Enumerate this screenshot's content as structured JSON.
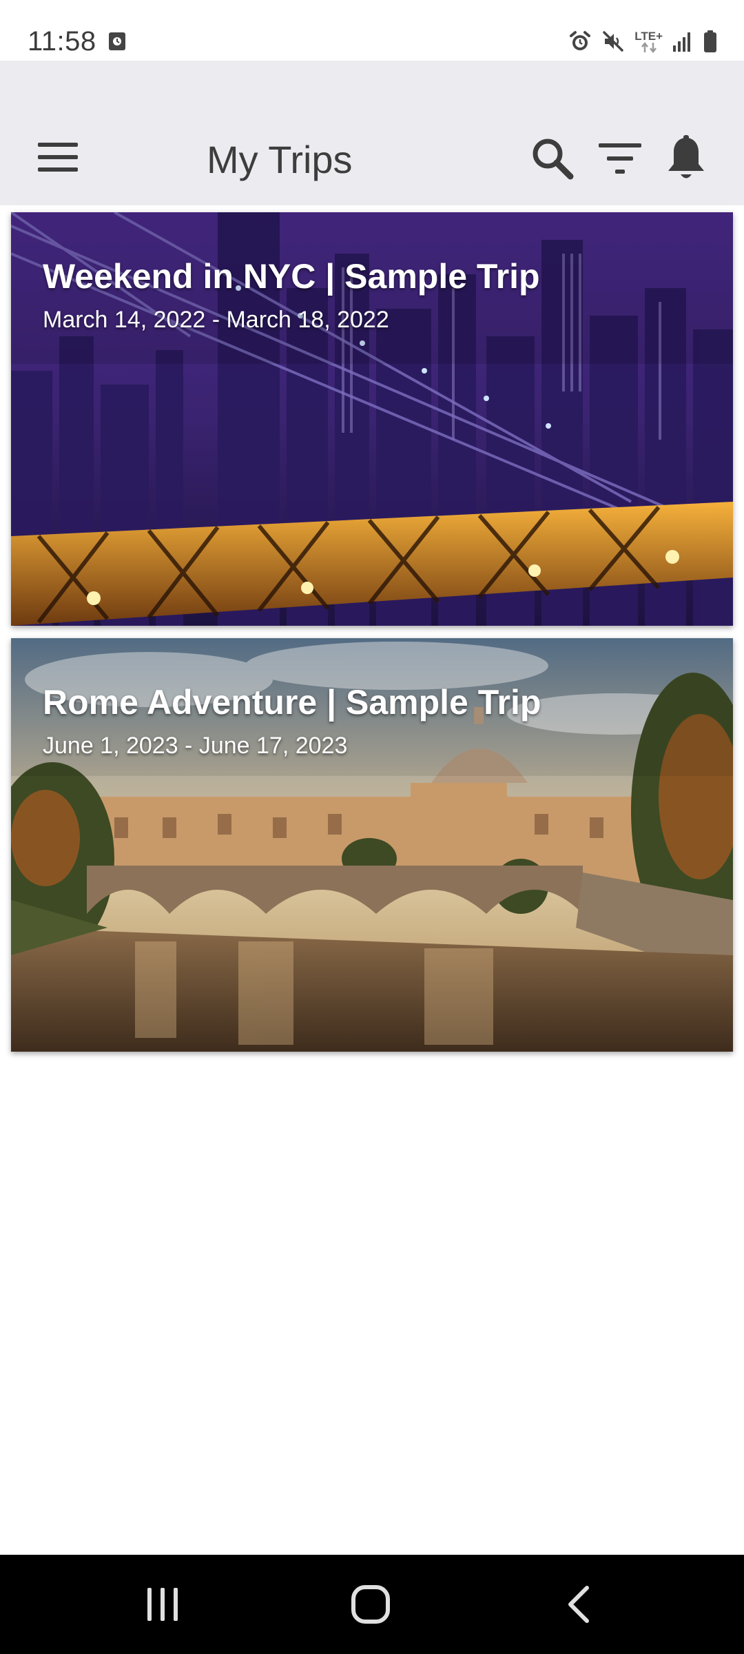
{
  "status_bar": {
    "time": "11:58",
    "network_label": "LTE+",
    "icons": [
      "screen-record-icon",
      "alarm-icon",
      "mute-icon",
      "lte-icon",
      "signal-icon",
      "battery-icon"
    ]
  },
  "app_bar": {
    "title": "My Trips",
    "icons": [
      "menu-icon",
      "search-icon",
      "filter-icon",
      "bell-icon"
    ],
    "background": "#ecebf0"
  },
  "trips": [
    {
      "title": "Weekend in NYC | Sample Trip",
      "dates": "March 14, 2022 - March 18, 2022",
      "image": "nyc-bridge-night-photo"
    },
    {
      "title": "Rome Adventure | Sample Trip",
      "dates": "June 1, 2023 - June 17, 2023",
      "image": "rome-river-bridge-photo"
    }
  ],
  "nav_bar": {
    "icons": [
      "recents-icon",
      "home-icon",
      "back-icon"
    ]
  }
}
